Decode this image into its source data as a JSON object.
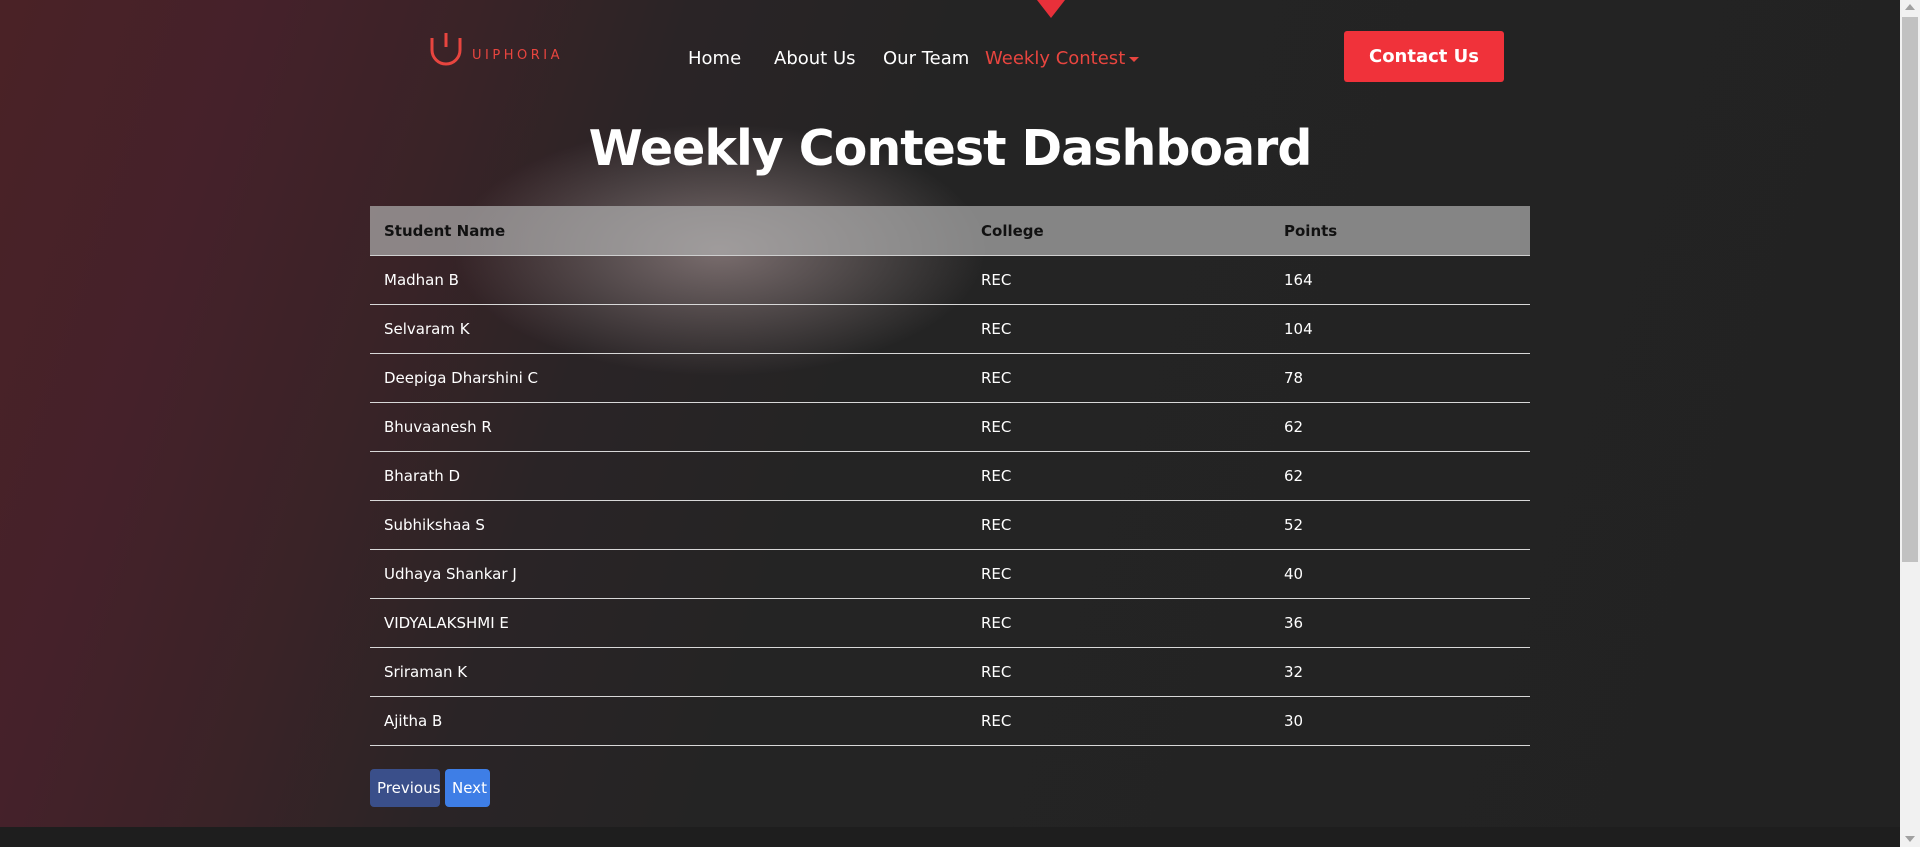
{
  "brand": {
    "logo_text": "UIPHORIA",
    "accent": "#e8453f"
  },
  "nav": {
    "items": [
      {
        "label": "Home"
      },
      {
        "label": "About Us"
      },
      {
        "label": "Our Team"
      },
      {
        "label": "Weekly Contest",
        "active": true
      }
    ],
    "contact_label": "Contact Us"
  },
  "page": {
    "title": "Weekly Contest Dashboard"
  },
  "table": {
    "headers": [
      "Student Name",
      "College",
      "Points"
    ],
    "rows": [
      {
        "name": "Madhan B",
        "college": "REC",
        "points": "164"
      },
      {
        "name": "Selvaram K",
        "college": "REC",
        "points": "104"
      },
      {
        "name": "Deepiga Dharshini C",
        "college": "REC",
        "points": "78"
      },
      {
        "name": "Bhuvaanesh R",
        "college": "REC",
        "points": "62"
      },
      {
        "name": "Bharath D",
        "college": "REC",
        "points": "62"
      },
      {
        "name": "Subhikshaa S",
        "college": "REC",
        "points": "52"
      },
      {
        "name": "Udhaya Shankar J",
        "college": "REC",
        "points": "40"
      },
      {
        "name": "VIDYALAKSHMI E",
        "college": "REC",
        "points": "36"
      },
      {
        "name": "Sriraman K",
        "college": "REC",
        "points": "32"
      },
      {
        "name": "Ajitha B",
        "college": "REC",
        "points": "30"
      }
    ]
  },
  "pagination": {
    "previous_label": "Previous",
    "next_label": "Next"
  },
  "colors": {
    "contact_button": "#f0323a",
    "previous_button": "#3a4f8a",
    "next_button": "#3e7ee6"
  }
}
